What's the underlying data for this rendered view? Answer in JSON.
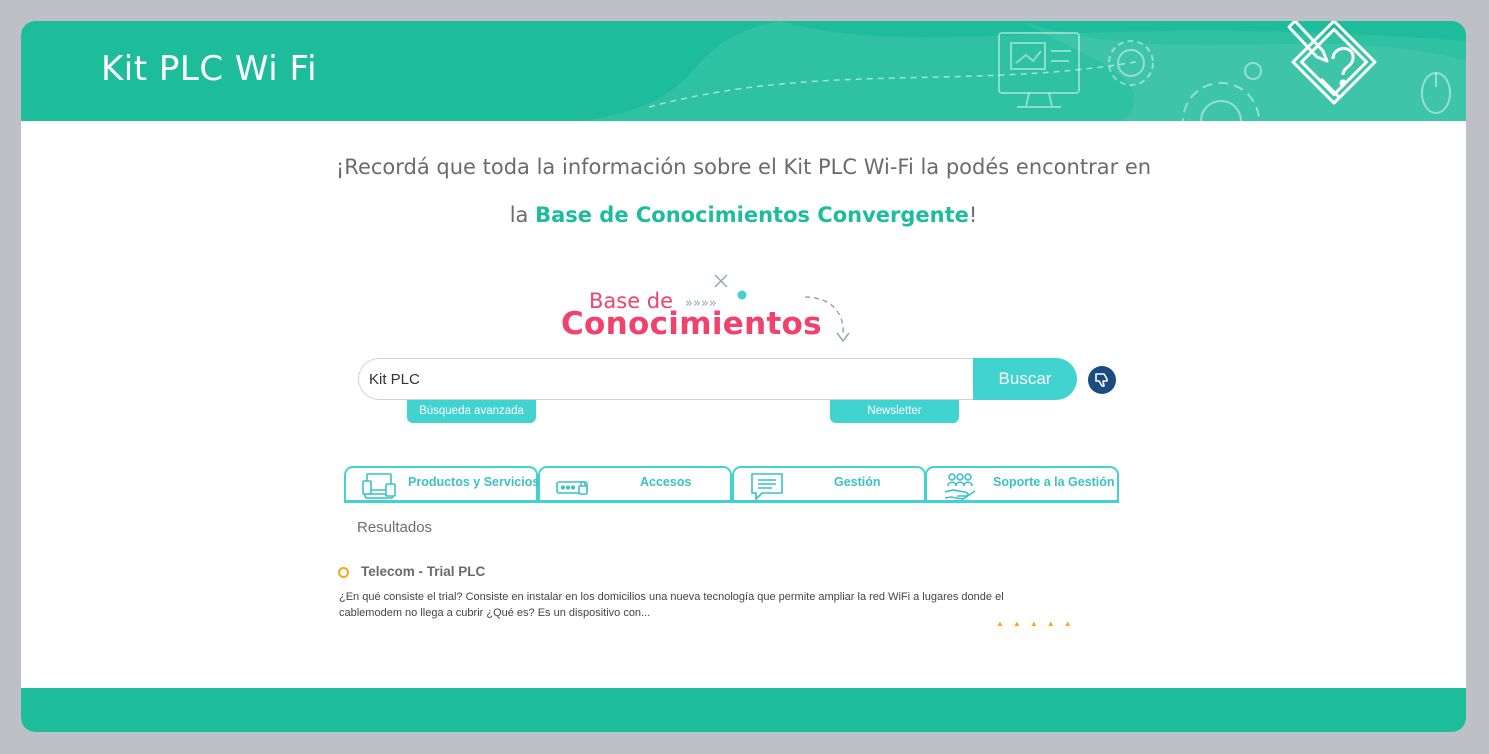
{
  "header": {
    "title": "Kit PLC Wi Fi"
  },
  "intro": {
    "line1": "¡Recordá que toda la información sobre el Kit PLC Wi-Fi la podés encontrar en",
    "line2_prefix": "la ",
    "line2_highlight": "Base de Conocimientos Convergente",
    "line2_suffix": "!"
  },
  "kb_logo": {
    "line1": "Base de",
    "line2": "Conocimientos"
  },
  "search": {
    "value": "Kit PLC",
    "button_label": "Buscar",
    "advanced_label": "Búsqueda avanzada",
    "newsletter_label": "Newsletter"
  },
  "tabs": [
    {
      "label": "Productos y Servicios",
      "icon": "devices-icon"
    },
    {
      "label": "Accesos",
      "icon": "password-icon"
    },
    {
      "label": "Gestión",
      "icon": "chat-icon"
    },
    {
      "label": "Soporte a la Gestión",
      "icon": "people-hand-icon"
    }
  ],
  "results": {
    "label": "Resultados",
    "items": [
      {
        "title": "Telecom - Trial PLC",
        "snippet": "¿En qué consiste el trial? Consiste en instalar en los domicilios una nueva tecnología que permite ampliar la red WiFi a lugares donde el cablemodem no llega a cubrir ¿Qué es? Es un dispositivo con...",
        "rating": 5
      }
    ]
  },
  "colors": {
    "brand_green": "#1dbc9b",
    "accent_cyan": "#41d3d0",
    "kb_pink": "#f0426c",
    "star_orange": "#f5a623",
    "thumb_blue": "#1b4c80"
  }
}
